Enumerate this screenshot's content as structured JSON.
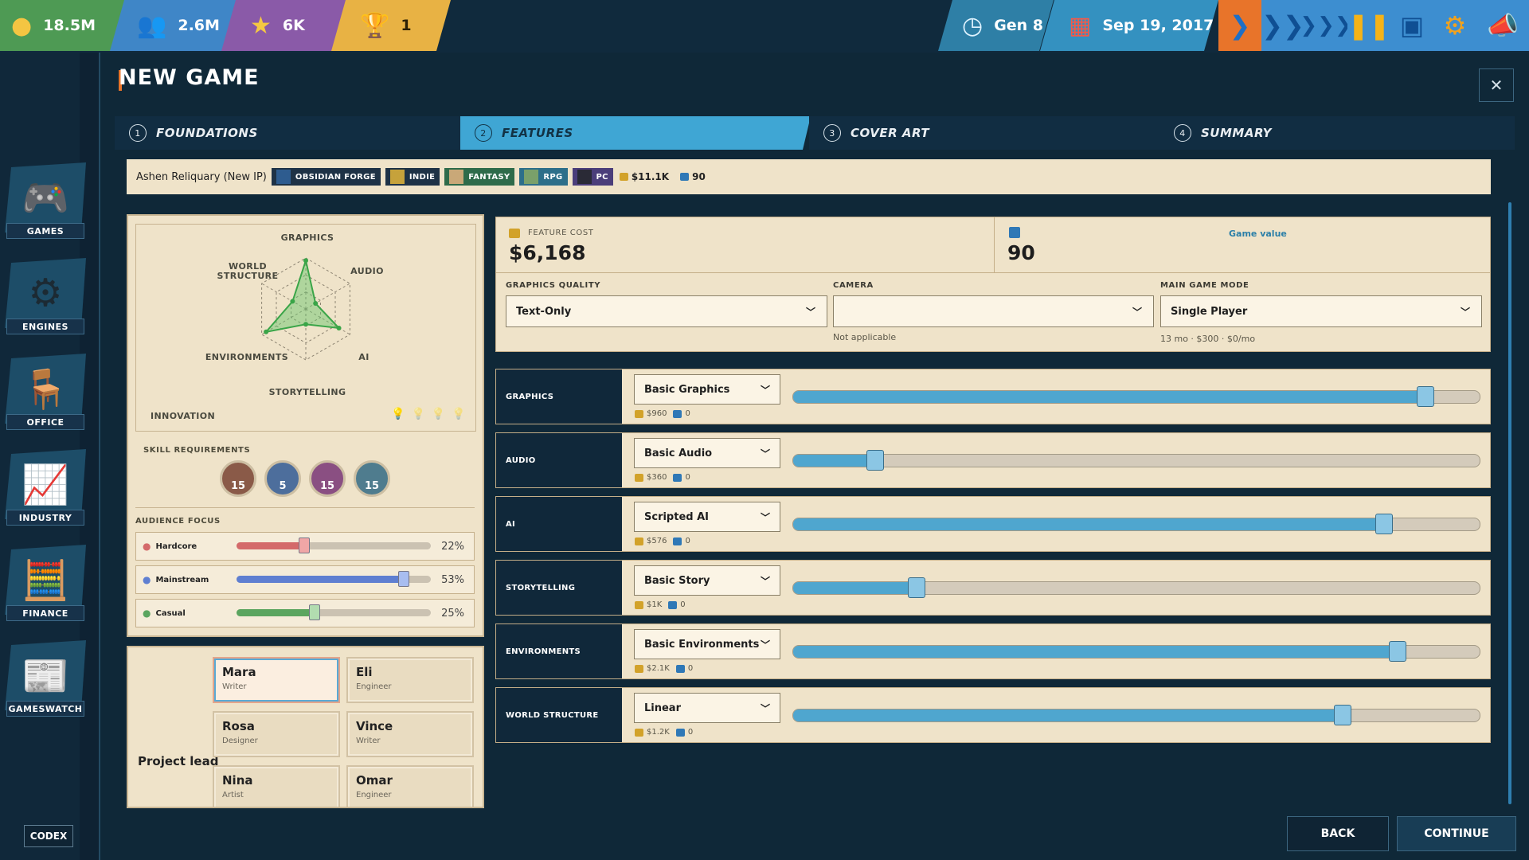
{
  "topbar": {
    "money": "18.5M",
    "fans": "2.6M",
    "reputation": "6K",
    "awards": "1",
    "generation": "Gen 8",
    "date": "Sep 19, 2017"
  },
  "sidebar": {
    "items": [
      {
        "label": "GAMES",
        "icon": "gamepad-icon"
      },
      {
        "label": "ENGINES",
        "icon": "gear-bolt-icon"
      },
      {
        "label": "OFFICE",
        "icon": "desk-chair-icon"
      },
      {
        "label": "INDUSTRY",
        "icon": "chart-growth-icon"
      },
      {
        "label": "FINANCE",
        "icon": "calculator-coin-icon"
      },
      {
        "label": "GAMESWATCH",
        "icon": "newspaper-icon"
      }
    ],
    "codex": "CODEX"
  },
  "dialog": {
    "title": "NEW GAME",
    "close": "✕",
    "steps": [
      {
        "num": "1",
        "label": "FOUNDATIONS"
      },
      {
        "num": "2",
        "label": "FEATURES"
      },
      {
        "num": "3",
        "label": "COVER ART"
      },
      {
        "num": "4",
        "label": "SUMMARY"
      }
    ],
    "active_step": 2
  },
  "info": {
    "game_name": "Ashen Reliquary (New IP)",
    "tags": [
      "OBSIDIAN FORGE",
      "INDIE",
      "FANTASY",
      "RPG",
      "PC"
    ],
    "cost": "$11.1K",
    "value": "90"
  },
  "radar": {
    "labels": {
      "graphics": "GRAPHICS",
      "audio": "AUDIO",
      "ai": "AI",
      "storytelling": "STORYTELLING",
      "environments": "ENVIRONMENTS",
      "world": "WORLD\nSTRUCTURE"
    },
    "innovation_label": "INNOVATION",
    "innovation_level": 1,
    "innovation_max": 4,
    "values": {
      "graphics": 0.95,
      "audio": 0.22,
      "ai": 0.75,
      "storytelling": 0.3,
      "environments": 0.9,
      "world": 0.3
    }
  },
  "skills": {
    "label": "SKILL REQUIREMENTS",
    "items": [
      {
        "value": "15",
        "color": "#8a5a48"
      },
      {
        "value": "5",
        "color": "#4d6e9c"
      },
      {
        "value": "15",
        "color": "#8a4f82"
      },
      {
        "value": "15",
        "color": "#4f7c8e"
      }
    ]
  },
  "audience": {
    "label": "AUDIENCE FOCUS",
    "items": [
      {
        "name": "Hardcore",
        "pct": "22%",
        "level": 0.35,
        "color": "#d46a6a",
        "knob": "#f0a6a6"
      },
      {
        "name": "Mainstream",
        "pct": "53%",
        "level": 0.86,
        "color": "#5f7fd1",
        "knob": "#a8bdf0"
      },
      {
        "name": "Casual",
        "pct": "25%",
        "level": 0.4,
        "color": "#5ba55f",
        "knob": "#b2dcb0"
      }
    ]
  },
  "project_lead": {
    "label": "Project lead",
    "staff": [
      {
        "name": "Mara",
        "role": "Writer",
        "selected": true
      },
      {
        "name": "Eli",
        "role": "Engineer"
      },
      {
        "name": "Rosa",
        "role": "Designer"
      },
      {
        "name": "Vince",
        "role": "Writer"
      },
      {
        "name": "Nina",
        "role": "Artist"
      },
      {
        "name": "Omar",
        "role": "Engineer"
      }
    ]
  },
  "summary": {
    "feature_cost_label": "FEATURE COST",
    "feature_cost": "$6,168",
    "game_value_label": "Game value",
    "game_value": "90"
  },
  "selects": {
    "graphics_quality": {
      "label": "GRAPHICS QUALITY",
      "value": "Text-Only"
    },
    "camera": {
      "label": "CAMERA",
      "value": "",
      "note": "Not applicable"
    },
    "main_mode": {
      "label": "MAIN GAME MODE",
      "value": "Single Player",
      "note": "13 mo · $300 · $0/mo"
    }
  },
  "features": [
    {
      "label": "GRAPHICS",
      "choice": "Basic Graphics",
      "cost": "$960",
      "value": "0",
      "level": 0.92
    },
    {
      "label": "AUDIO",
      "choice": "Basic Audio",
      "cost": "$360",
      "value": "0",
      "level": 0.12
    },
    {
      "label": "AI",
      "choice": "Scripted AI",
      "cost": "$576",
      "value": "0",
      "level": 0.86
    },
    {
      "label": "STORYTELLING",
      "choice": "Basic Story",
      "cost": "$1K",
      "value": "0",
      "level": 0.18
    },
    {
      "label": "ENVIRONMENTS",
      "choice": "Basic Environments",
      "cost": "$2.1K",
      "value": "0",
      "level": 0.88
    },
    {
      "label": "WORLD STRUCTURE",
      "choice": "Linear",
      "cost": "$1.2K",
      "value": "0",
      "level": 0.8
    }
  ],
  "buttons": {
    "back": "BACK",
    "continue": "CONTINUE"
  }
}
